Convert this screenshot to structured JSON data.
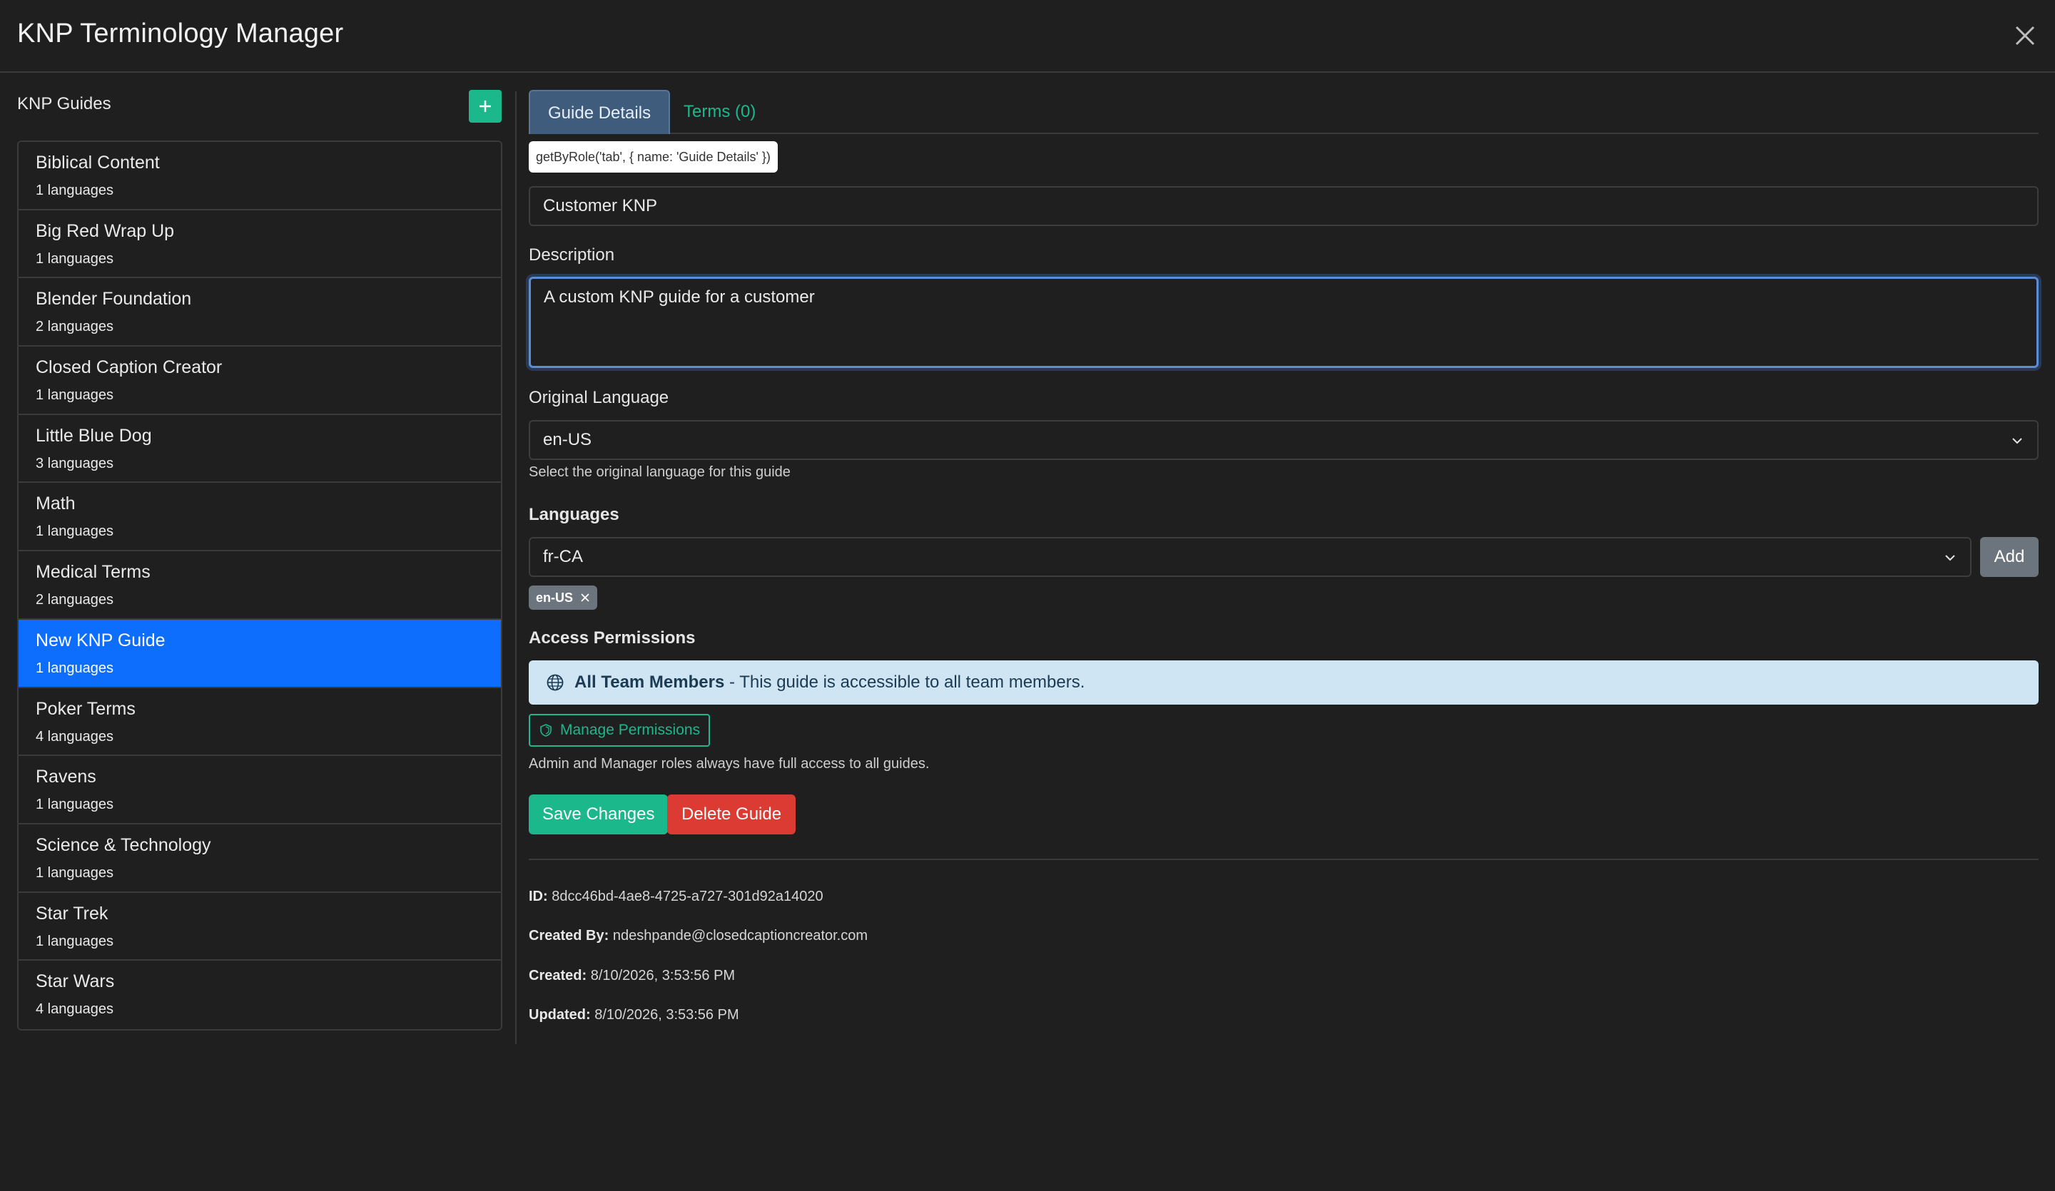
{
  "header": {
    "title": "KNP Terminology Manager"
  },
  "sidebar": {
    "title": "KNP Guides",
    "add_label": "+",
    "items": [
      {
        "name": "Biblical Content",
        "langs": "1 languages"
      },
      {
        "name": "Big Red Wrap Up",
        "langs": "1 languages"
      },
      {
        "name": "Blender Foundation",
        "langs": "2 languages"
      },
      {
        "name": "Closed Caption Creator",
        "langs": "1 languages"
      },
      {
        "name": "Little Blue Dog",
        "langs": "3 languages"
      },
      {
        "name": "Math",
        "langs": "1 languages"
      },
      {
        "name": "Medical Terms",
        "langs": "2 languages"
      },
      {
        "name": "New KNP Guide",
        "langs": "1 languages",
        "active": true
      },
      {
        "name": "Poker Terms",
        "langs": "4 languages"
      },
      {
        "name": "Ravens",
        "langs": "1 languages"
      },
      {
        "name": "Science & Technology",
        "langs": "1 languages"
      },
      {
        "name": "Star Trek",
        "langs": "1 languages"
      },
      {
        "name": "Star Wars",
        "langs": "4 languages"
      }
    ]
  },
  "tabs": [
    {
      "label": "Guide Details",
      "active": true
    },
    {
      "label": "Terms (0)",
      "active": false
    }
  ],
  "tooltip": "getByRole('tab', { name: 'Guide Details' })",
  "form": {
    "name_value": "Customer KNP",
    "description_label": "Description",
    "description_value": "A custom KNP guide for a customer",
    "original_language_label": "Original Language",
    "original_language_value": "en-US",
    "original_language_help": "Select the original language for this guide",
    "languages_label": "Languages",
    "languages_select_value": "fr-CA",
    "add_label": "Add",
    "language_chip": "en-US"
  },
  "access": {
    "label": "Access Permissions",
    "strong": "All Team Members",
    "rest": " - This guide is accessible to all team members.",
    "manage_label": "Manage Permissions",
    "note": "Admin and Manager roles always have full access to all guides."
  },
  "actions": {
    "save_label": "Save Changes",
    "delete_label": "Delete Guide"
  },
  "meta": {
    "id_label": "ID:",
    "id_value": " 8dcc46bd-4ae8-4725-a727-301d92a14020",
    "created_by_label": "Created By:",
    "created_by_value": " ndeshpande@closedcaptioncreator.com",
    "created_label": "Created:",
    "created_value": " 8/10/2026, 3:53:56 PM",
    "updated_label": "Updated:",
    "updated_value": " 8/10/2026, 3:53:56 PM"
  },
  "colors": {
    "accent": "#1bb88c",
    "active_item": "#0d6efd",
    "danger": "#dc3b34",
    "info_bg": "#cfe5f3"
  },
  "icons": {
    "close": "close-icon",
    "add": "plus-icon",
    "chevron": "chevron-down-icon",
    "globe": "globe-icon",
    "shield": "shield-icon",
    "chip_remove": "close-icon"
  }
}
